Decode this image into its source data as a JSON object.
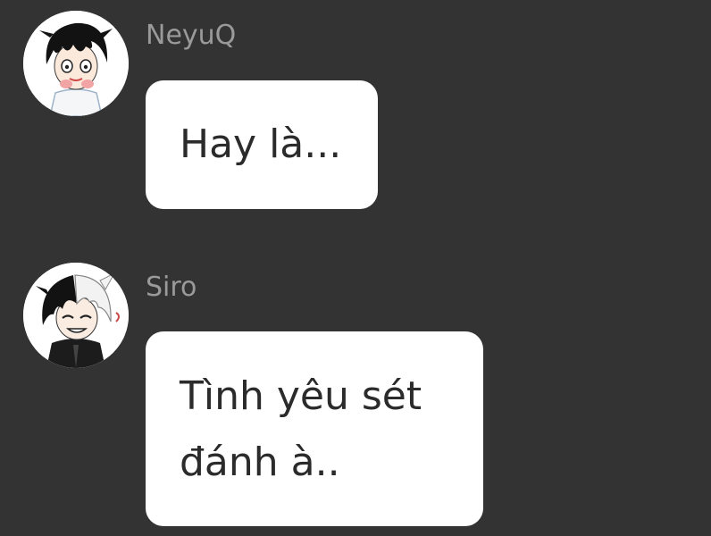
{
  "colors": {
    "background": "#333333",
    "bubble": "#ffffff",
    "username": "#9a9a9a",
    "message_text": "#2b2b2b"
  },
  "messages": [
    {
      "sender": "NeyuQ",
      "avatar_icon": "avatar-neyuq-icon",
      "text": "Hay là..."
    },
    {
      "sender": "Siro",
      "avatar_icon": "avatar-siro-icon",
      "text": "Tình yêu sét\nđánh à.."
    }
  ]
}
